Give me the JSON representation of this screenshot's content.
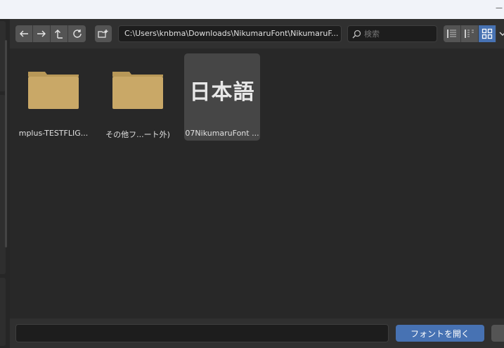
{
  "toolbar": {
    "path": "C:\\Users\\knbma\\Downloads\\NikumaruFont\\NikumaruF...",
    "search_placeholder": "検索"
  },
  "files": [
    {
      "label": "mplus-TESTFLIG...",
      "type": "folder"
    },
    {
      "label": "その他フ...ート外)",
      "type": "folder"
    },
    {
      "label": "07NikumaruFont ...",
      "type": "font",
      "preview": "日本語",
      "selected": true
    }
  ],
  "bottom": {
    "filename_value": "",
    "open_label": "フォントを開く"
  },
  "colors": {
    "accent": "#4772b3",
    "folder": "#c9a867",
    "panel": "#282828"
  }
}
